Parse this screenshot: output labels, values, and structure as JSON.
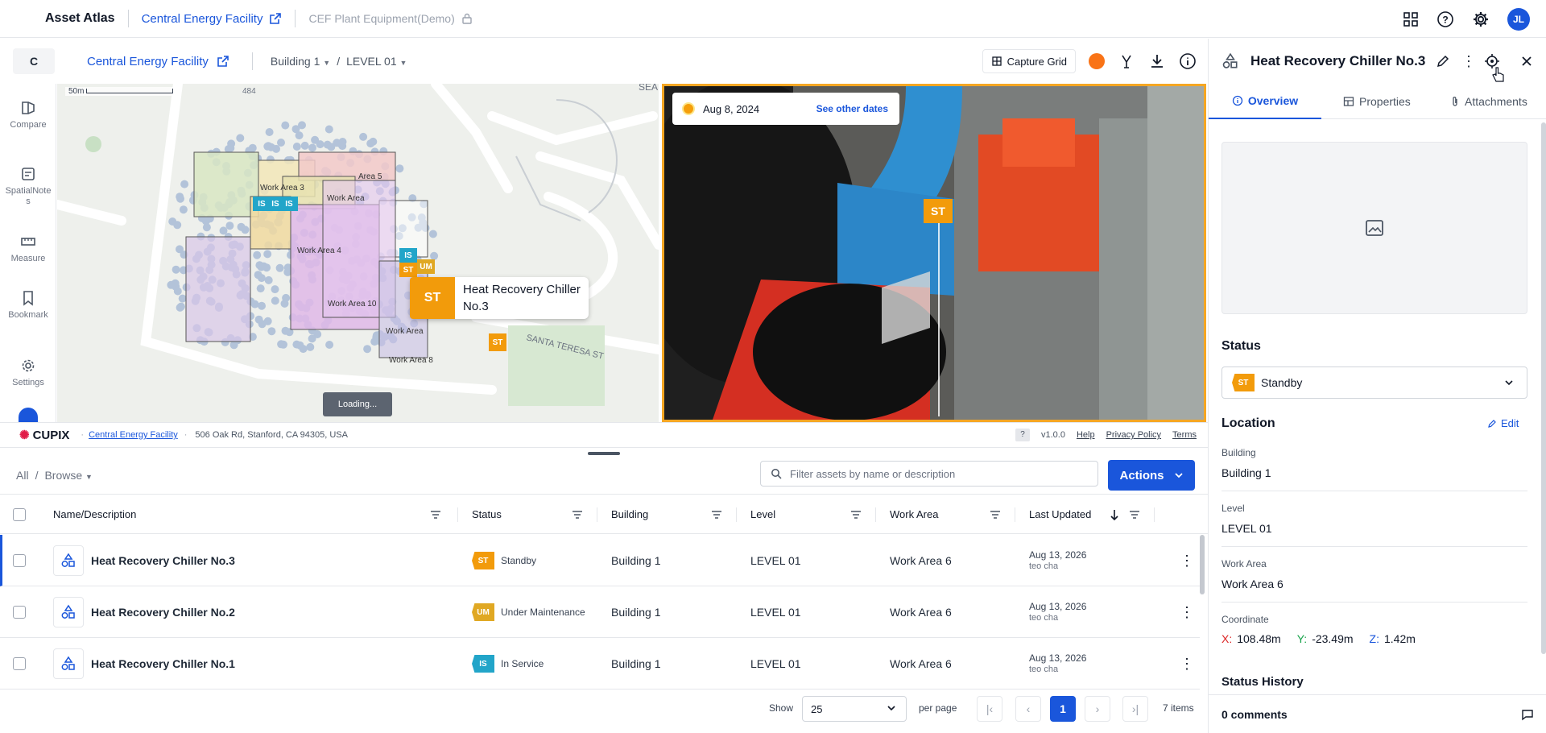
{
  "app": {
    "name": "Asset Atlas"
  },
  "topbar": {
    "facility_link": "Central Energy Facility",
    "locked_project": "CEF Plant Equipment(Demo)",
    "user_initials": "JL"
  },
  "subbar": {
    "project_initial": "C",
    "facility_link": "Central Energy Facility",
    "building": "Building 1",
    "separator": "/",
    "level": "LEVEL 01",
    "capture_grid": "Capture Grid"
  },
  "rail": {
    "items": [
      {
        "label": "Compare",
        "icon": "compare-icon"
      },
      {
        "label": "SpatialNotes",
        "icon": "spatial-notes-icon"
      },
      {
        "label": "Measure",
        "icon": "measure-icon"
      },
      {
        "label": "Bookmark",
        "icon": "bookmark-icon"
      },
      {
        "label": "Settings",
        "icon": "gear-icon"
      }
    ]
  },
  "map": {
    "scale_label": "50m",
    "street_number": "484",
    "street_sea": "SEA",
    "street_santa_teresa": "SANTA TERESA ST",
    "areas": [
      "Area 5",
      "Work Area 3",
      "Work Area",
      "Work Area 4",
      "Work Area 10",
      "Work Area",
      "Work Area 8"
    ],
    "tooltip_code": "ST",
    "tooltip_title": "Heat Recovery Chiller No.3",
    "loading": "Loading..."
  },
  "photo": {
    "date": "Aug 8, 2024",
    "see_other_dates": "See other dates",
    "marker_code": "ST"
  },
  "footer": {
    "brand": "CUPIX",
    "facility_link": "Central Energy Facility",
    "address": "506 Oak Rd, Stanford, CA 94305, USA",
    "help_q": "?",
    "version": "v1.0.0",
    "help": "Help",
    "privacy": "Privacy Policy",
    "terms": "Terms"
  },
  "toolbar": {
    "breadcrumb_all": "All",
    "breadcrumb_sep": "/",
    "browse": "Browse",
    "search_placeholder": "Filter assets by name or description",
    "actions": "Actions"
  },
  "table": {
    "columns": [
      "Name/Description",
      "Status",
      "Building",
      "Level",
      "Work Area",
      "Last Updated"
    ],
    "rows": [
      {
        "name": "Heat Recovery Chiller No.3",
        "status_code": "ST",
        "status": "Standby",
        "building": "Building 1",
        "level": "LEVEL 01",
        "work_area": "Work Area 6",
        "updated": "Aug 13, 2026",
        "by": "teo cha"
      },
      {
        "name": "Heat Recovery Chiller No.2",
        "status_code": "UM",
        "status": "Under Maintenance",
        "building": "Building 1",
        "level": "LEVEL 01",
        "work_area": "Work Area 6",
        "updated": "Aug 13, 2026",
        "by": "teo cha"
      },
      {
        "name": "Heat Recovery Chiller No.1",
        "status_code": "IS",
        "status": "In Service",
        "building": "Building 1",
        "level": "LEVEL 01",
        "work_area": "Work Area 6",
        "updated": "Aug 13, 2026",
        "by": "teo cha"
      }
    ]
  },
  "pager": {
    "show": "Show",
    "per_page_value": "25",
    "per_page": "per page",
    "current_page": "1",
    "total": "7 items"
  },
  "panel": {
    "title": "Heat Recovery Chiller No.3",
    "tabs": [
      "Overview",
      "Properties",
      "Attachments"
    ],
    "status_heading": "Status",
    "status_code": "ST",
    "status_value": "Standby",
    "location_heading": "Location",
    "edit": "Edit",
    "building_label": "Building",
    "building_value": "Building 1",
    "level_label": "Level",
    "level_value": "LEVEL 01",
    "work_area_label": "Work Area",
    "work_area_value": "Work Area 6",
    "coordinate_label": "Coordinate",
    "x_label": "X:",
    "x_value": "108.48m",
    "y_label": "Y:",
    "y_value": "-23.49m",
    "z_label": "Z:",
    "z_value": "1.42m",
    "status_history": "Status History",
    "comments": "0 comments"
  },
  "colors": {
    "accent": "#1a56db",
    "standby": "#f29b0b",
    "maintenance": "#e0a823",
    "in_service": "#22a5c9",
    "photo_frame": "#f5a623"
  }
}
